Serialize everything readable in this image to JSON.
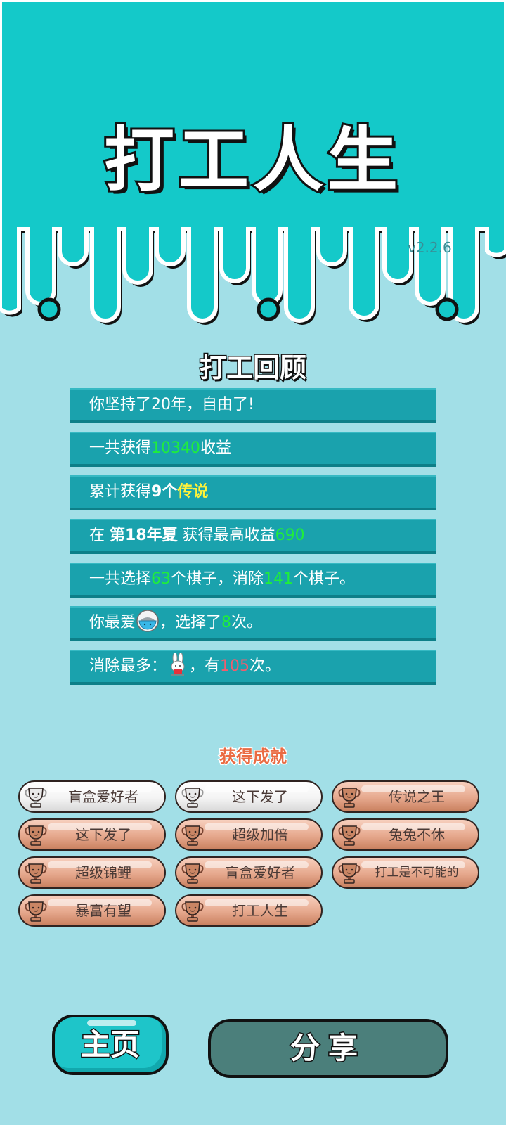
{
  "header": {
    "title": "打工人生",
    "version": "v2.2.6"
  },
  "review": {
    "title": "打工回顾",
    "rows": [
      {
        "parts": [
          {
            "text": "你坚持了20年，自由了!"
          }
        ]
      },
      {
        "parts": [
          {
            "text": "一共获得"
          },
          {
            "text": "10340",
            "style": "green"
          },
          {
            "text": "收益"
          }
        ]
      },
      {
        "parts": [
          {
            "text": "累计获得"
          },
          {
            "text": "9个",
            "style": "bold"
          },
          {
            "text": "传说",
            "style": "yellow"
          }
        ]
      },
      {
        "parts": [
          {
            "text": "在 "
          },
          {
            "text": "第18年夏",
            "style": "bold"
          },
          {
            "text": " 获得最高收益"
          },
          {
            "text": "690",
            "style": "green"
          }
        ]
      },
      {
        "parts": [
          {
            "text": "一共选择"
          },
          {
            "text": "63",
            "style": "green"
          },
          {
            "text": "个棋子，消除"
          },
          {
            "text": "141",
            "style": "green"
          },
          {
            "text": "个棋子。"
          }
        ]
      },
      {
        "parts": [
          {
            "text": "你最爱"
          },
          {
            "icon": "rice-bowl-icon"
          },
          {
            "text": "，选择了"
          },
          {
            "text": "8",
            "style": "green"
          },
          {
            "text": "次。"
          }
        ]
      },
      {
        "parts": [
          {
            "text": "消除最多："
          },
          {
            "icon": "rabbit-icon"
          },
          {
            "text": "，有"
          },
          {
            "text": "105",
            "style": "red"
          },
          {
            "text": "次。"
          }
        ]
      }
    ]
  },
  "achievements": {
    "title": "获得成就",
    "items": [
      {
        "label": "盲盒爱好者",
        "tier": "silver"
      },
      {
        "label": "这下发了",
        "tier": "silver"
      },
      {
        "label": "传说之王",
        "tier": "bronze"
      },
      {
        "label": "这下发了",
        "tier": "bronze"
      },
      {
        "label": "超级加倍",
        "tier": "bronze"
      },
      {
        "label": "兔兔不休",
        "tier": "bronze"
      },
      {
        "label": "超级锦鲤",
        "tier": "bronze"
      },
      {
        "label": "盲盒爱好者",
        "tier": "bronze"
      },
      {
        "label": "打工是不可能的",
        "tier": "bronze"
      },
      {
        "label": "暴富有望",
        "tier": "bronze"
      },
      {
        "label": "打工人生",
        "tier": "bronze"
      }
    ]
  },
  "buttons": {
    "home_label": "主页",
    "share_label": "分享"
  },
  "colors": {
    "header_bg": "#14c9c9",
    "page_bg": "#a2dfe7",
    "row_bg": "#1aa2ad",
    "accent_green": "#1fee3a",
    "accent_yellow": "#fff239",
    "accent_red": "#f25d6d",
    "achievement_title": "#ea6b43"
  }
}
